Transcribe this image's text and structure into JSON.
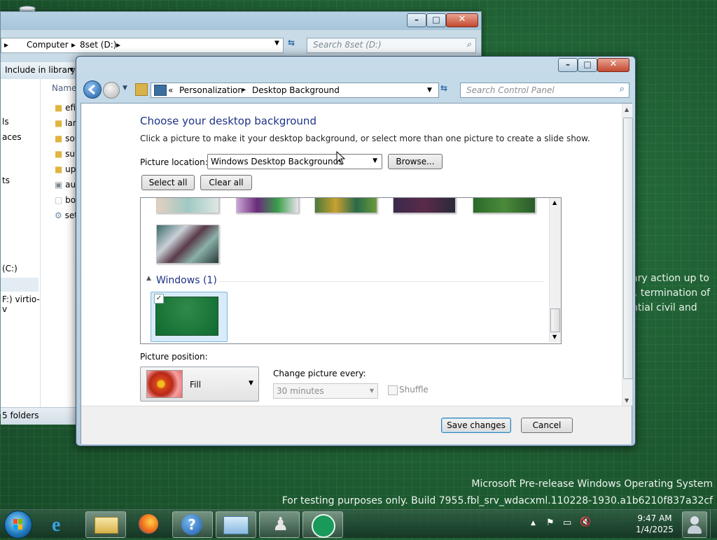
{
  "desktop": {
    "behind_text": [
      "ary action up to",
      "', termination of",
      "ntial civil and"
    ],
    "watermark_line1": "Microsoft Pre-release Windows Operating System",
    "watermark_line2": "For testing purposes only. Build 7955.fbl_srv_wdacxml.110228-1930.a1b6210f837a32cf"
  },
  "explorer": {
    "breadcrumb": [
      "Computer",
      "8set (D:)"
    ],
    "search_placeholder": "Search 8set (D:)",
    "include_library": "Include in library",
    "column_name": "Name",
    "files": [
      "efi",
      "lang",
      "sou",
      "sup",
      "upg",
      "au",
      "boo",
      "setu"
    ],
    "left_items": [
      "ls",
      "aces",
      "ts",
      "(C:)",
      "F:) virtio-v"
    ],
    "status": "5 folders"
  },
  "window": {
    "address": [
      "Personalization",
      "Desktop Background"
    ],
    "address_prefix": "«",
    "search_placeholder": "Search Control Panel",
    "title": "Choose your desktop background",
    "subtitle": "Click a picture to make it your desktop background, or select more than one picture to create a slide show.",
    "picture_location_label": "Picture location:",
    "picture_location_value": "Windows Desktop Backgrounds",
    "browse_button": "Browse...",
    "select_all_button": "Select all",
    "clear_all_button": "Clear all",
    "group_label": "Windows (1)",
    "picture_position_label": "Picture position:",
    "picture_position_value": "Fill",
    "change_every_label": "Change picture every:",
    "change_every_value": "30 minutes",
    "shuffle_label": "Shuffle",
    "save_button": "Save changes",
    "cancel_button": "Cancel"
  },
  "taskbar": {
    "time": "9:47 AM",
    "date": "1/4/2025",
    "apps": [
      "start-orb",
      "internet-explorer",
      "file-explorer",
      "firefox",
      "help-and-support",
      "control-panel",
      "chess",
      "app-green"
    ]
  },
  "colors": {
    "title_blue": "#1e3287",
    "desktop_green": "#1f5f33"
  }
}
